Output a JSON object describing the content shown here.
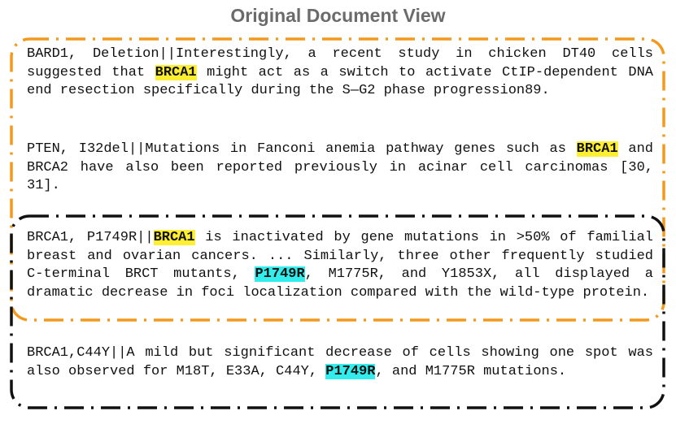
{
  "page": {
    "title": "Original Document View"
  },
  "colors": {
    "orange_frame": "#f39a1e",
    "black_frame": "#111111",
    "highlight_gene": "#ffef33",
    "highlight_variant": "#33ecec"
  },
  "paragraphs": [
    {
      "pre": "BARD1, Deletion||Interestingly, a recent study in chicken DT40 cells suggested that ",
      "hl": "BRCA1",
      "hl_type": "gene",
      "post": " might act as a switch to activate CtIP-dependent DNA end resection specifically during the S—G2 phase progression89."
    },
    {
      "pre": "PTEN, I32del||Mutations in Fanconi anemia pathway genes such as ",
      "hl": "BRCA1",
      "hl_type": "gene",
      "post": " and BRCA2 have also been reported previously in acinar cell carcinomas [30, 31]."
    },
    {
      "pre": "BRCA1, P1749R||",
      "hl": "BRCA1",
      "hl_type": "gene",
      "mid": " is inactivated by gene mutations in >50% of familial breast and ovarian cancers. ... Similarly, three other frequently studied C-terminal BRCT mutants, ",
      "hl2": "P1749R",
      "hl2_type": "variant",
      "post": ", M1775R, and Y1853X, all displayed a dramatic decrease in foci localization compared with the wild-type protein."
    },
    {
      "pre": "BRCA1,C44Y||A mild but significant decrease of cells showing one spot was also observed for M18T, E33A, C44Y, ",
      "hl": "P1749R",
      "hl_type": "variant",
      "post": ", and M1775R mutations."
    }
  ]
}
